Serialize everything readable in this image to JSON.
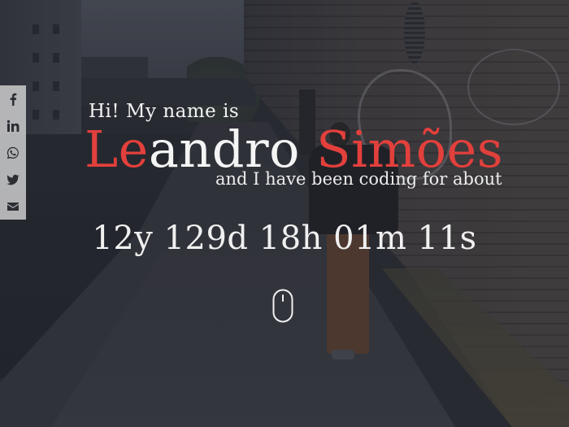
{
  "social": {
    "items": [
      {
        "name": "facebook",
        "icon": "facebook-icon"
      },
      {
        "name": "linkedin",
        "icon": "linkedin-icon"
      },
      {
        "name": "whatsapp",
        "icon": "whatsapp-icon"
      },
      {
        "name": "twitter",
        "icon": "twitter-icon"
      },
      {
        "name": "email",
        "icon": "envelope-icon"
      }
    ],
    "bar_color": "#cdcdcd"
  },
  "hero": {
    "greeting": "Hi! My name is",
    "first_name_accent": "Le",
    "first_name_rest": "andro",
    "last_name": "Simões",
    "tagline": "and I have been coding for about",
    "counter": "12y 129d 18h 01m 11s",
    "accent_color": "#e2403c"
  },
  "scroll_indicator": {
    "icon": "mouse-scroll-icon"
  }
}
